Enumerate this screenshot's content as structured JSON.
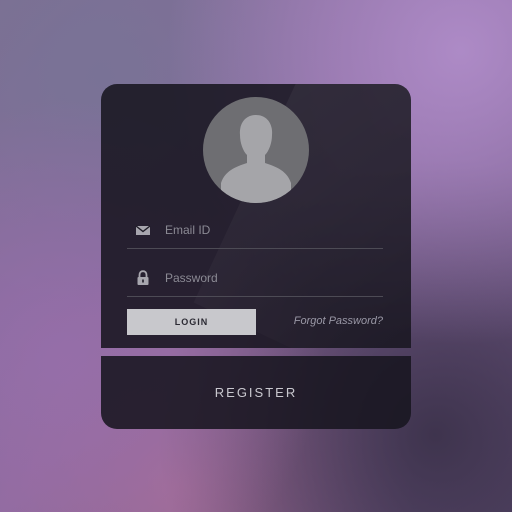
{
  "login_form": {
    "avatar_icon": "user-silhouette-icon",
    "email": {
      "icon": "envelope-icon",
      "placeholder": "Email ID",
      "value": ""
    },
    "password": {
      "icon": "lock-icon",
      "placeholder": "Password",
      "value": ""
    },
    "login_label": "LOGIN",
    "forgot_label": "Forgot Password?",
    "register_label": "REGISTER"
  },
  "colors": {
    "card": "#18161f",
    "button": "#c8c8cc",
    "avatar": "#6e6e72",
    "divider": "#4d4b55"
  }
}
